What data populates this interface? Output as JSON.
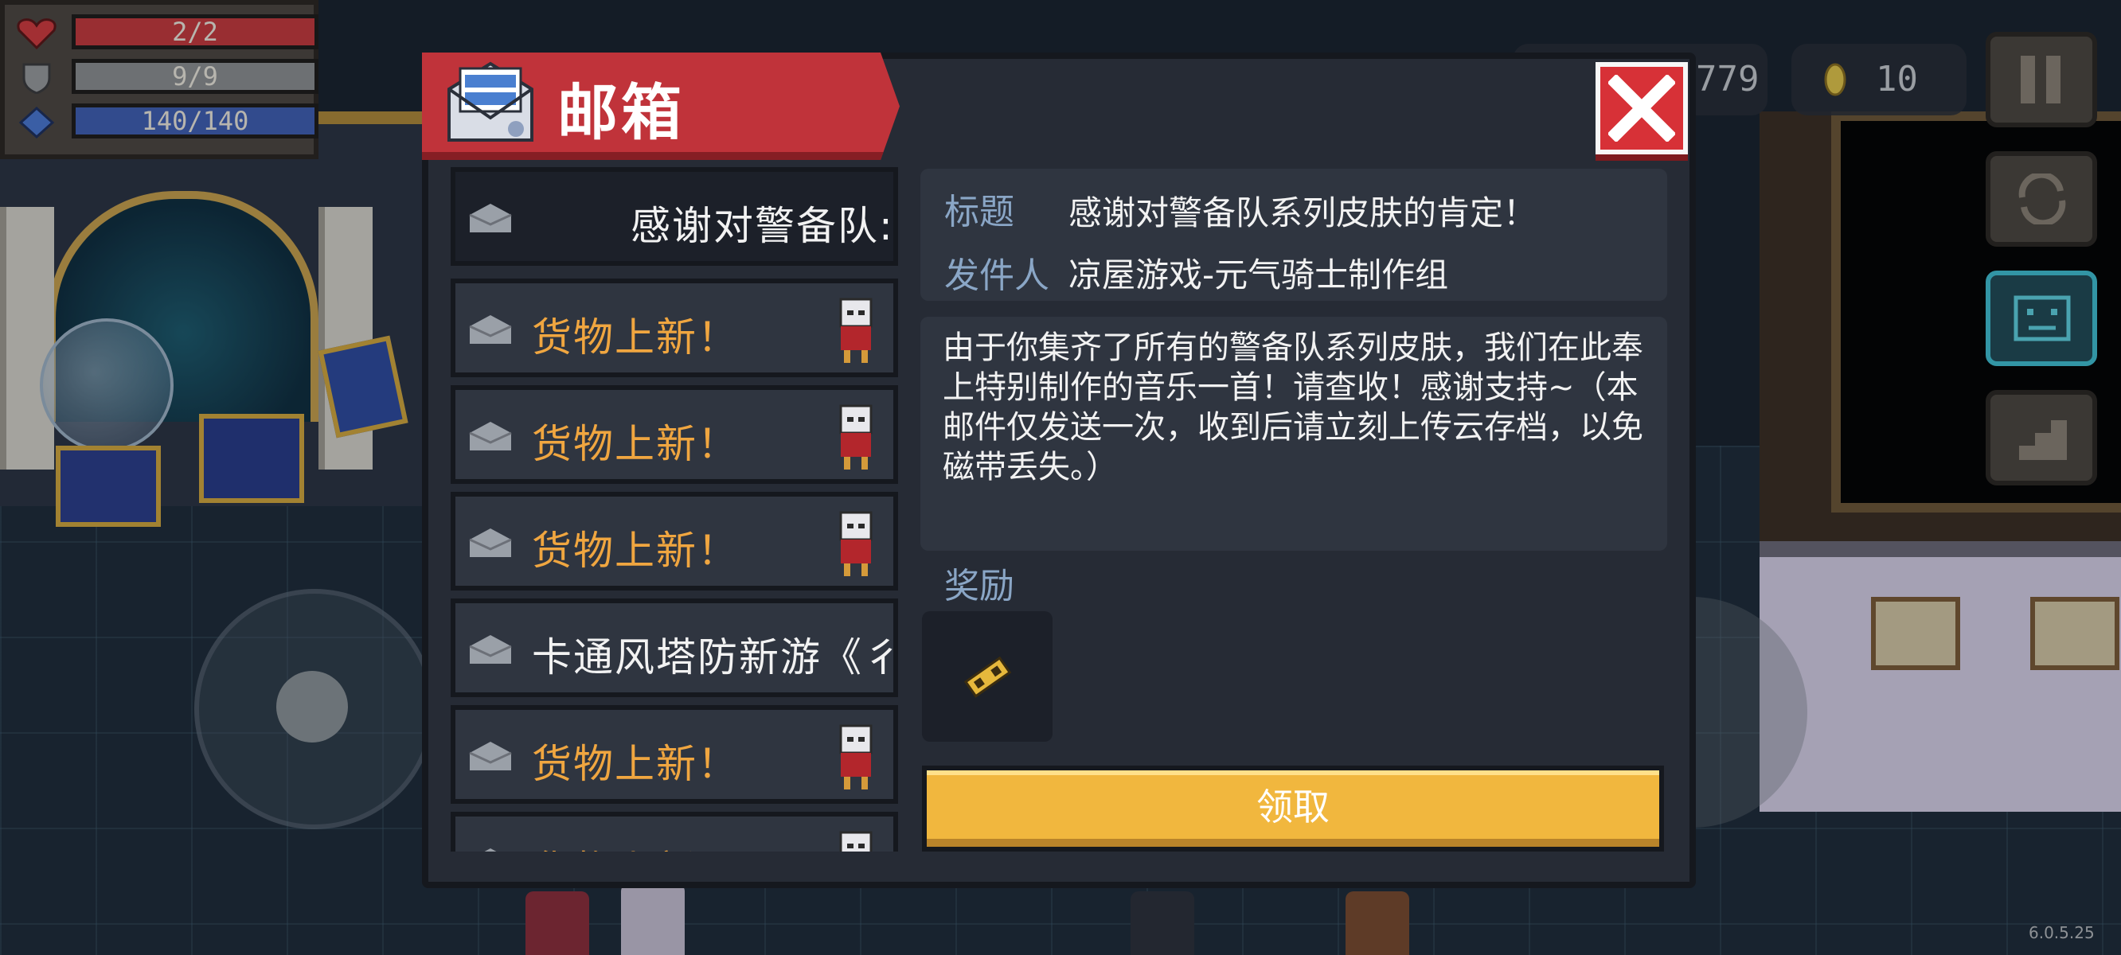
{
  "status": {
    "hp": "2/2",
    "armor": "9/9",
    "energy": "140/140",
    "colors": {
      "hp": "#c8383c",
      "armor": "#8e9093",
      "energy": "#3f5fb6"
    }
  },
  "topbar": {
    "gems": "779",
    "coins": "10"
  },
  "mailbox": {
    "title": "邮箱",
    "close_icon": "close-icon",
    "list": [
      {
        "label": "感谢对警备队:",
        "style": "white",
        "selected": true
      },
      {
        "label": "货物上新！",
        "style": "orange"
      },
      {
        "label": "货物上新！",
        "style": "orange"
      },
      {
        "label": "货物上新！",
        "style": "orange"
      },
      {
        "label": "卡通风塔防新游《彳",
        "style": "white"
      },
      {
        "label": "货物上新！",
        "style": "orange"
      },
      {
        "label": "货物上新！",
        "style": "orange"
      }
    ],
    "detail": {
      "subject_label": "标题",
      "subject": "感谢对警备队系列皮肤的肯定！",
      "sender_label": "发件人",
      "sender": "凉屋游戏-元气骑士制作组",
      "body": "由于你集齐了所有的警备队系列皮肤，我们在此奉上特别制作的音乐一首！请查收！感谢支持~（本邮件仅发送一次，收到后请立刻上传云存档，以免磁带丢失。）",
      "reward_label": "奖励",
      "reward_icon": "cassette-icon"
    },
    "claim_label": "领取"
  },
  "version": "6.0.5.25"
}
